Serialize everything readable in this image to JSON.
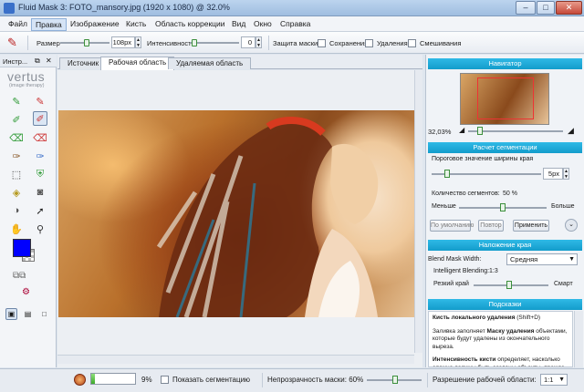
{
  "window": {
    "title": "Fluid Mask 3: FOTO_mansory.jpg (1920 x 1080) @ 32.0%",
    "min": "–",
    "max": "□",
    "close": "✕"
  },
  "menu": [
    "Файл",
    "Правка",
    "Изображение",
    "Кисть",
    "Область коррекции",
    "Вид",
    "Окно",
    "Справка"
  ],
  "toolbar": {
    "size_label": "Размер",
    "size_value": "108px",
    "intensity_label": "Интенсивность",
    "intensity_value": "0",
    "protect_label": "Защита маски:",
    "save_label": "Сохранения",
    "delete_label": "Удаления",
    "mix_label": "Смешивания"
  },
  "tools_panel": {
    "title": "Инстр...",
    "logo": "vertus",
    "logo_sub": "(image therapy)"
  },
  "tabs": [
    "Источник",
    "Рабочая область",
    "Удаляемая область"
  ],
  "navigator": {
    "title": "Навигатор",
    "zoom": "32,03%"
  },
  "segmentation": {
    "title": "Расчет сегментации",
    "edge_label": "Пороговое значение ширины края",
    "edge_value": "5px",
    "count_label": "Количество сегментов:",
    "count_value": "50 %",
    "less": "Меньше",
    "more": "Больше",
    "default_btn": "По умолчанию",
    "repeat_btn": "Повтор",
    "apply_btn": "Применить"
  },
  "edge_blend": {
    "title": "Наложение края",
    "width_label": "Blend Mask Width:",
    "width_value": "Средняя",
    "intelligent_label": "Intelligent Blending:",
    "intelligent_value": "1:3",
    "sharp": "Резкий край",
    "smooth": "Смарт"
  },
  "hints": {
    "title": "Подсказки",
    "head": "Кисть локального удаления",
    "shortcut": "(Shift+D)",
    "p1a": "Заливка заполняет ",
    "p1b": "Маску удаления",
    "p1c": " объектами, которые будут удалены из окончательного вырезa.",
    "p2a": "Интенсивность кисти",
    "p2b": " определяет, насколько сложно должны быть созданы объекты, прежде"
  },
  "status": {
    "progress_pct": "9%",
    "progress_value": 0.09,
    "show_seg": "Показать сегментацию",
    "opacity": "Непрозрачность маски: 60%",
    "resolution_label": "Разрешение рабочей области:",
    "resolution_value": "1:1"
  },
  "colors": {
    "accent": "#139ccb",
    "foreground": "#0000ff",
    "background": "#ffffff"
  }
}
